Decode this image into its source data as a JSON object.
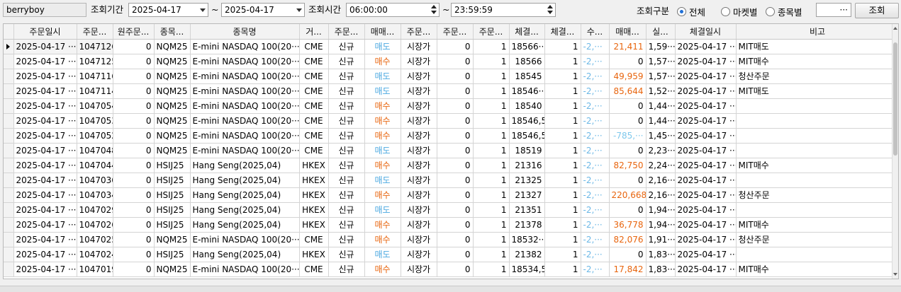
{
  "toolbar": {
    "account": "berryboy",
    "period_label": "조회기간",
    "date_from": "2025-04-17",
    "tilde": "~",
    "date_to": "2025-04-17",
    "time_label": "조회시간",
    "time_from": "06:00:00",
    "time_to": "23:59:59",
    "type_label": "조회구분",
    "radio_all": "전체",
    "radio_market": "마켓별",
    "radio_symbol": "종목별",
    "extra_field": "···",
    "search_button": "조회"
  },
  "columns": [
    "주문일시",
    "주문...",
    "원주문...",
    "종목...",
    "종목명",
    "거...",
    "주문...",
    "매매...",
    "주문...",
    "주문...",
    "주문...",
    "체결...",
    "체결...",
    "수...",
    "매매...",
    "실...",
    "체결일시",
    "비고"
  ],
  "rows": [
    [
      "2025-04-17 ···",
      "1047126",
      "0",
      "NQM25",
      "E-mini NASDAQ 100(20···",
      "CME",
      "신규",
      "매도",
      "시장가",
      "0",
      "1",
      "18566···",
      "1",
      "-2,···",
      "21,411",
      "1,59···",
      "2025-04-17 ···",
      "MIT매도"
    ],
    [
      "2025-04-17 ···",
      "1047125",
      "0",
      "NQM25",
      "E-mini NASDAQ 100(20···",
      "CME",
      "신규",
      "매수",
      "시장가",
      "0",
      "1",
      "18566",
      "1",
      "-2,···",
      "0",
      "1,57···",
      "2025-04-17 ···",
      "MIT매수"
    ],
    [
      "2025-04-17 ···",
      "1047116",
      "0",
      "NQM25",
      "E-mini NASDAQ 100(20···",
      "CME",
      "신규",
      "매도",
      "시장가",
      "0",
      "1",
      "18545",
      "1",
      "-2,···",
      "49,959",
      "1,57···",
      "2025-04-17 ···",
      "청산주문"
    ],
    [
      "2025-04-17 ···",
      "1047114",
      "0",
      "NQM25",
      "E-mini NASDAQ 100(20···",
      "CME",
      "신규",
      "매도",
      "시장가",
      "0",
      "1",
      "18546···",
      "1",
      "-2,···",
      "85,644",
      "1,52···",
      "2025-04-17 ···",
      "MIT매도"
    ],
    [
      "2025-04-17 ···",
      "1047054",
      "0",
      "NQM25",
      "E-mini NASDAQ 100(20···",
      "CME",
      "신규",
      "매수",
      "시장가",
      "0",
      "1",
      "18540",
      "1",
      "-2,···",
      "0",
      "1,44···",
      "2025-04-17 ···",
      ""
    ],
    [
      "2025-04-17 ···",
      "1047053",
      "0",
      "NQM25",
      "E-mini NASDAQ 100(20···",
      "CME",
      "신규",
      "매수",
      "시장가",
      "0",
      "1",
      "18546,5",
      "1",
      "-2,···",
      "0",
      "1,44···",
      "2025-04-17 ···",
      ""
    ],
    [
      "2025-04-17 ···",
      "1047052",
      "0",
      "NQM25",
      "E-mini NASDAQ 100(20···",
      "CME",
      "신규",
      "매수",
      "시장가",
      "0",
      "1",
      "18546,5",
      "1",
      "-2,···",
      "-785,···",
      "1,45···",
      "2025-04-17 ···",
      ""
    ],
    [
      "2025-04-17 ···",
      "1047048",
      "0",
      "NQM25",
      "E-mini NASDAQ 100(20···",
      "CME",
      "신규",
      "매도",
      "시장가",
      "0",
      "1",
      "18519",
      "1",
      "-2,···",
      "0",
      "2,23···",
      "2025-04-17 ···",
      ""
    ],
    [
      "2025-04-17 ···",
      "1047044",
      "0",
      "HSIJ25",
      "Hang Seng(2025,04)",
      "HKEX",
      "신규",
      "매수",
      "시장가",
      "0",
      "1",
      "21316",
      "1",
      "-2,···",
      "82,750",
      "2,24···",
      "2025-04-17 ···",
      "MIT매수"
    ],
    [
      "2025-04-17 ···",
      "1047036",
      "0",
      "HSIJ25",
      "Hang Seng(2025,04)",
      "HKEX",
      "신규",
      "매도",
      "시장가",
      "0",
      "1",
      "21325",
      "1",
      "-2,···",
      "0",
      "2,16···",
      "2025-04-17 ···",
      ""
    ],
    [
      "2025-04-17 ···",
      "1047034",
      "0",
      "HSIJ25",
      "Hang Seng(2025,04)",
      "HKEX",
      "신규",
      "매수",
      "시장가",
      "0",
      "1",
      "21327",
      "1",
      "-2,···",
      "220,668",
      "2,16···",
      "2025-04-17 ···",
      "청산주문"
    ],
    [
      "2025-04-17 ···",
      "1047029",
      "0",
      "HSIJ25",
      "Hang Seng(2025,04)",
      "HKEX",
      "신규",
      "매도",
      "시장가",
      "0",
      "1",
      "21351",
      "1",
      "-2,···",
      "0",
      "1,94···",
      "2025-04-17 ···",
      ""
    ],
    [
      "2025-04-17 ···",
      "1047026",
      "0",
      "HSIJ25",
      "Hang Seng(2025,04)",
      "HKEX",
      "신규",
      "매수",
      "시장가",
      "0",
      "1",
      "21378",
      "1",
      "-2,···",
      "36,778",
      "1,94···",
      "2025-04-17 ···",
      "MIT매수"
    ],
    [
      "2025-04-17 ···",
      "1047025",
      "0",
      "NQM25",
      "E-mini NASDAQ 100(20···",
      "CME",
      "신규",
      "매수",
      "시장가",
      "0",
      "1",
      "18532···",
      "1",
      "-2,···",
      "82,076",
      "1,91···",
      "2025-04-17 ···",
      "청산주문"
    ],
    [
      "2025-04-17 ···",
      "1047024",
      "0",
      "HSIJ25",
      "Hang Seng(2025,04)",
      "HKEX",
      "신규",
      "매도",
      "시장가",
      "0",
      "1",
      "21382",
      "1",
      "-2,···",
      "0",
      "1,83···",
      "2025-04-17 ···",
      ""
    ],
    [
      "2025-04-17 ···",
      "1047019",
      "0",
      "NQM25",
      "E-mini NASDAQ 100(20···",
      "CME",
      "신규",
      "매수",
      "시장가",
      "0",
      "1",
      "18534,5",
      "1",
      "-2,···",
      "17,842",
      "1,83···",
      "2025-04-17 ···",
      "MIT매수"
    ]
  ],
  "colors": {
    "sell": "#4aa8e0",
    "buy": "#e8650e",
    "profit": "#e8650e",
    "loss": "#7ec8ec",
    "radio_selected": "#1f6fd6"
  },
  "icons": {
    "row_pointer": "row-pointer-icon",
    "combo": "chevron-down-icon",
    "spin": "spin-arrows-icon"
  }
}
